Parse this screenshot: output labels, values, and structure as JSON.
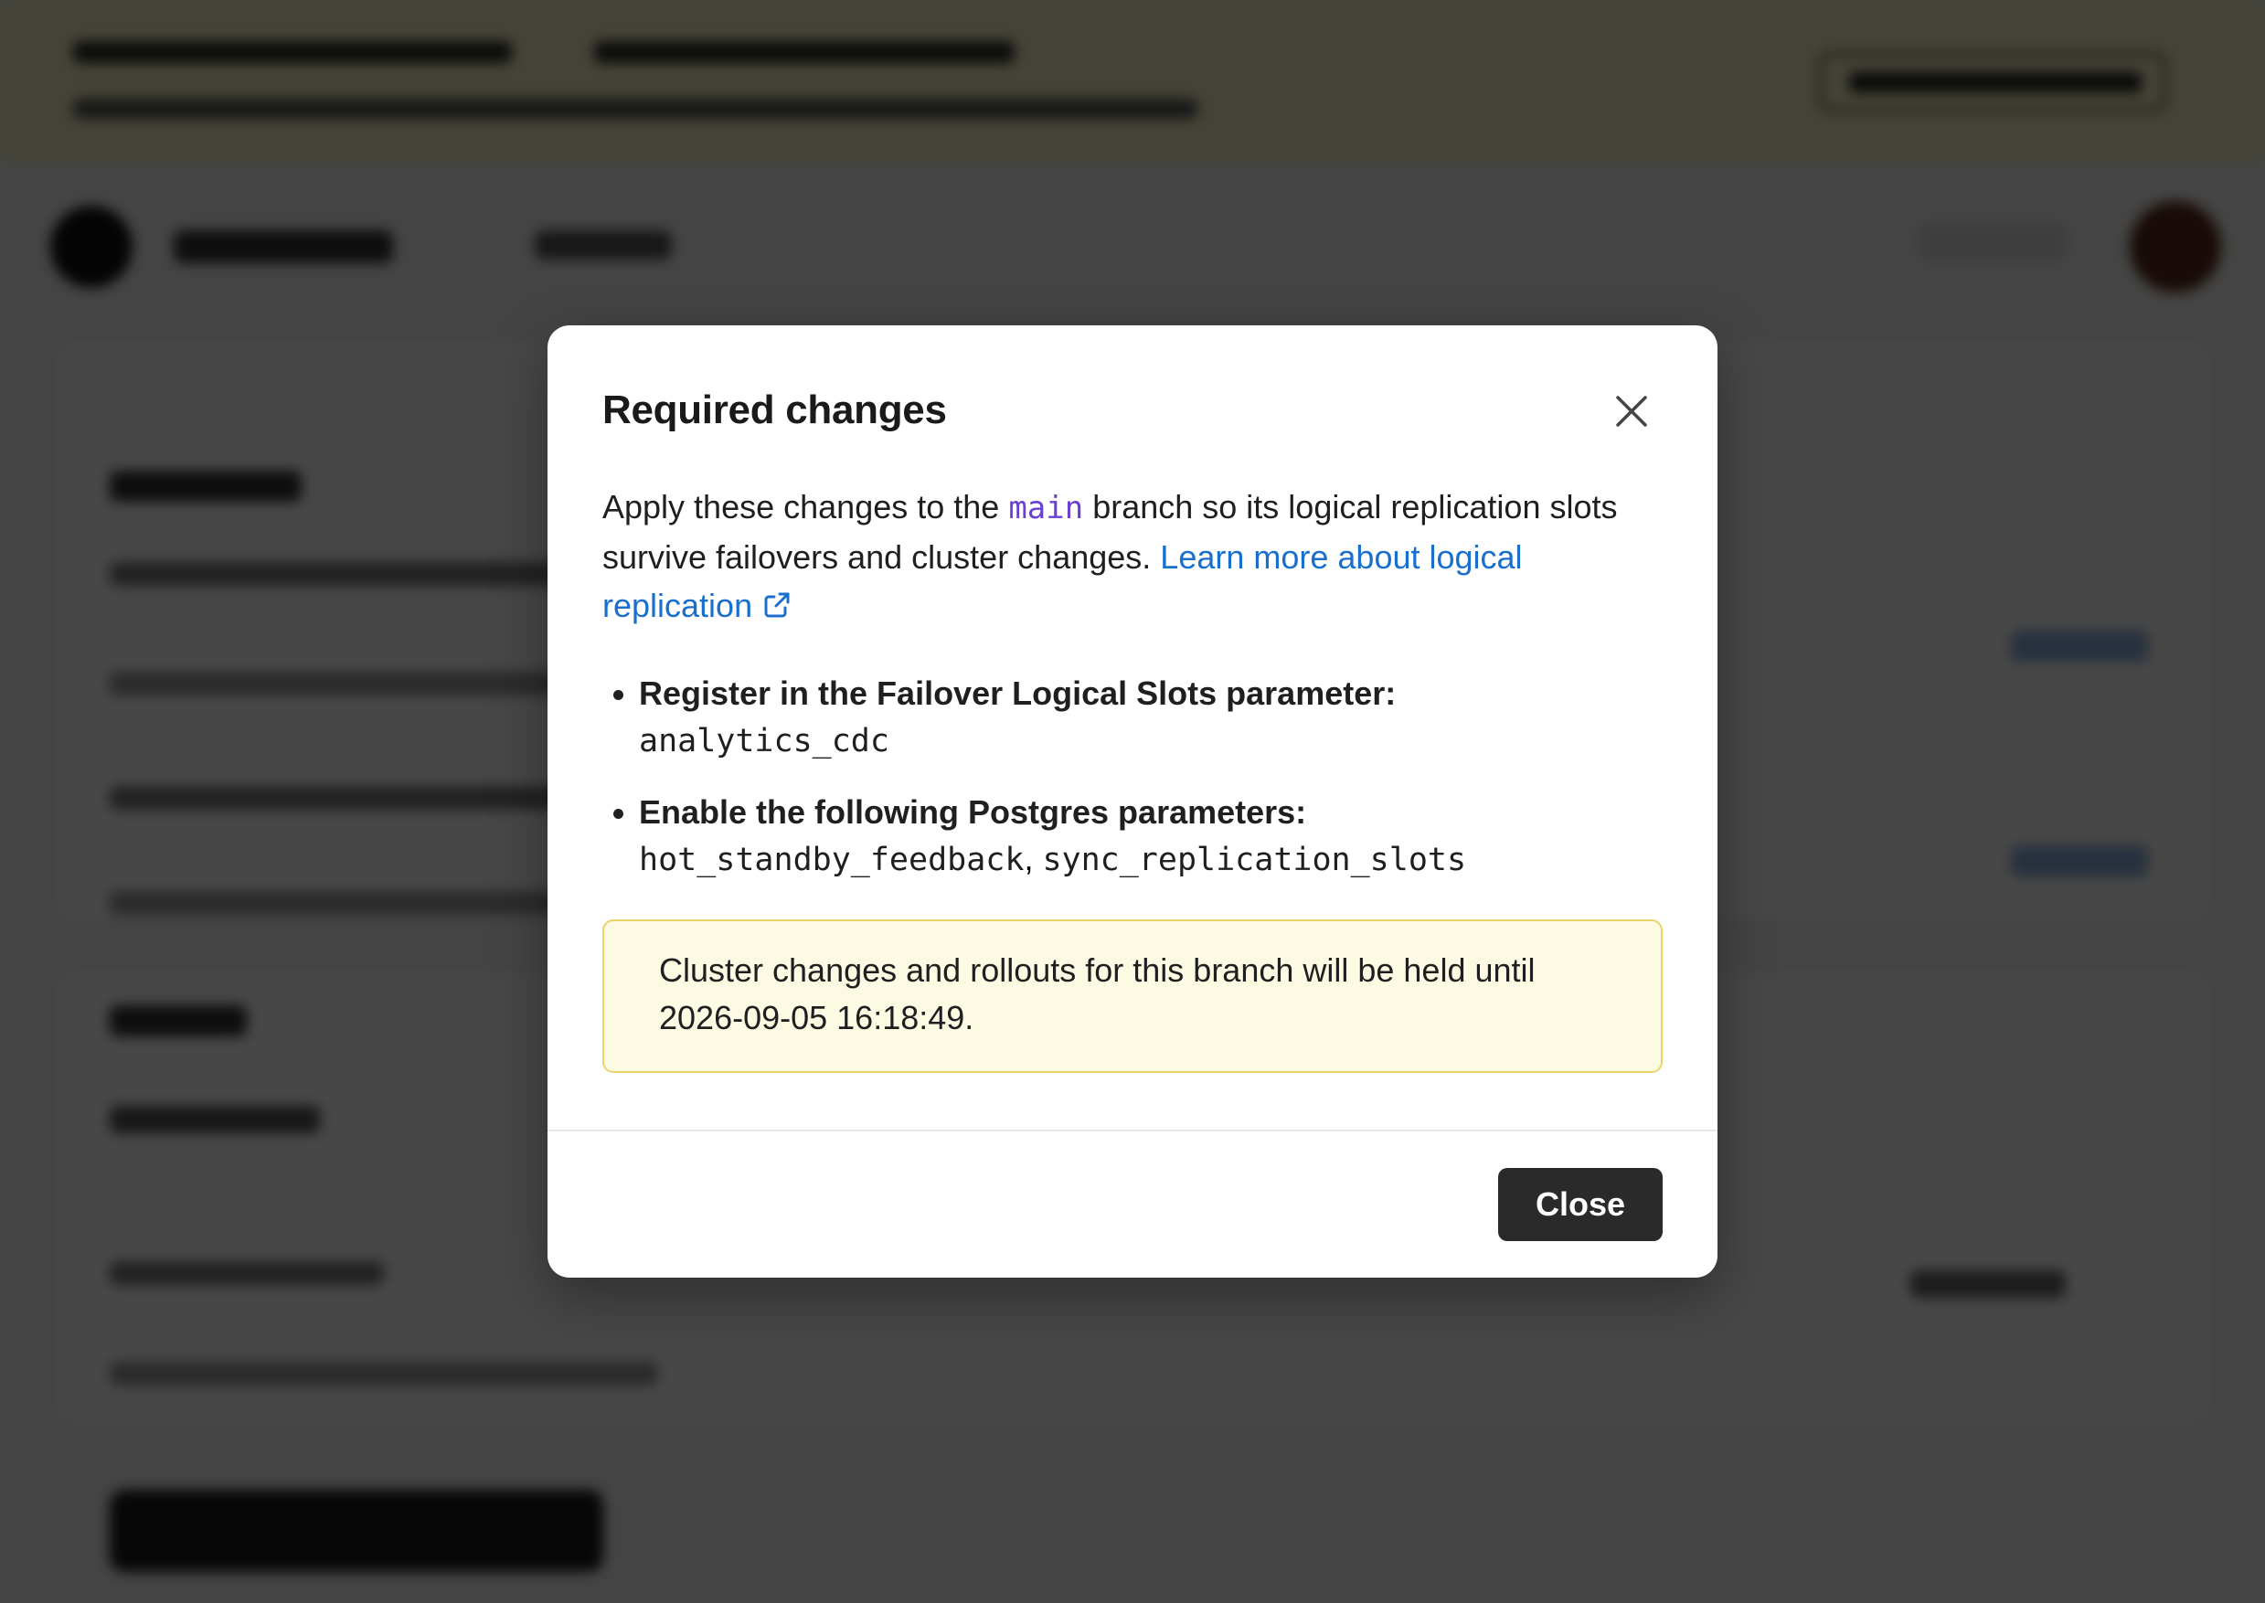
{
  "modal": {
    "title": "Required changes",
    "intro_prefix": "Apply these changes to the ",
    "branch_name": "main",
    "intro_suffix": " branch so its logical replication slots survive failovers and cluster changes. ",
    "learn_more_link": "Learn more about logical replication",
    "requirements": [
      {
        "label": "Register in the Failover Logical Slots parameter:",
        "codes": [
          "analytics_cdc"
        ]
      },
      {
        "label": "Enable the following Postgres parameters:",
        "codes": [
          "hot_standby_feedback",
          "sync_replication_slots"
        ]
      }
    ],
    "notice_text": "Cluster changes and rollouts for this branch will be held until ",
    "notice_datetime": "2026-09-05 16:18:49",
    "notice_end": ".",
    "close_button_label": "Close",
    "icons": {
      "close": "close-icon",
      "external_link": "external-link-icon"
    }
  },
  "colors": {
    "accent_link": "#1a6fce",
    "branch_code": "#6b3fd4",
    "notice_background": "#fcfae3",
    "notice_border": "#ead46a",
    "primary_button": "#2a2a2a"
  }
}
